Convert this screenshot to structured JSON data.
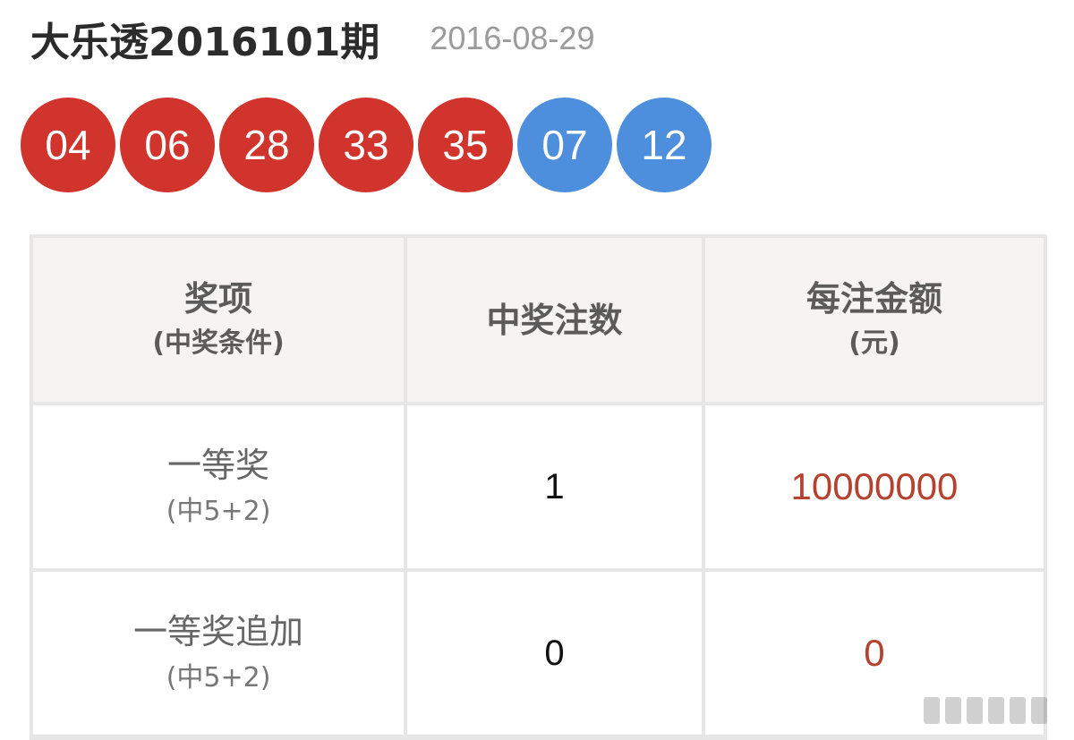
{
  "header": {
    "title": "大乐透2016101期",
    "date": "2016-08-29"
  },
  "balls": {
    "front": [
      "04",
      "06",
      "28",
      "33",
      "35"
    ],
    "back": [
      "07",
      "12"
    ],
    "front_color": "#d1342c",
    "back_color": "#4d8fdc"
  },
  "table": {
    "headers": {
      "col1_main": "奖项",
      "col1_sub": "(中奖条件)",
      "col2": "中奖注数",
      "col3_main": "每注金额",
      "col3_sub": "(元)"
    },
    "rows": [
      {
        "name": "一等奖",
        "condition": "(中5+2)",
        "count": "1",
        "amount": "10000000"
      },
      {
        "name": "一等奖追加",
        "condition": "(中5+2)",
        "count": "0",
        "amount": "0"
      }
    ],
    "amount_color": "#b6412f"
  }
}
